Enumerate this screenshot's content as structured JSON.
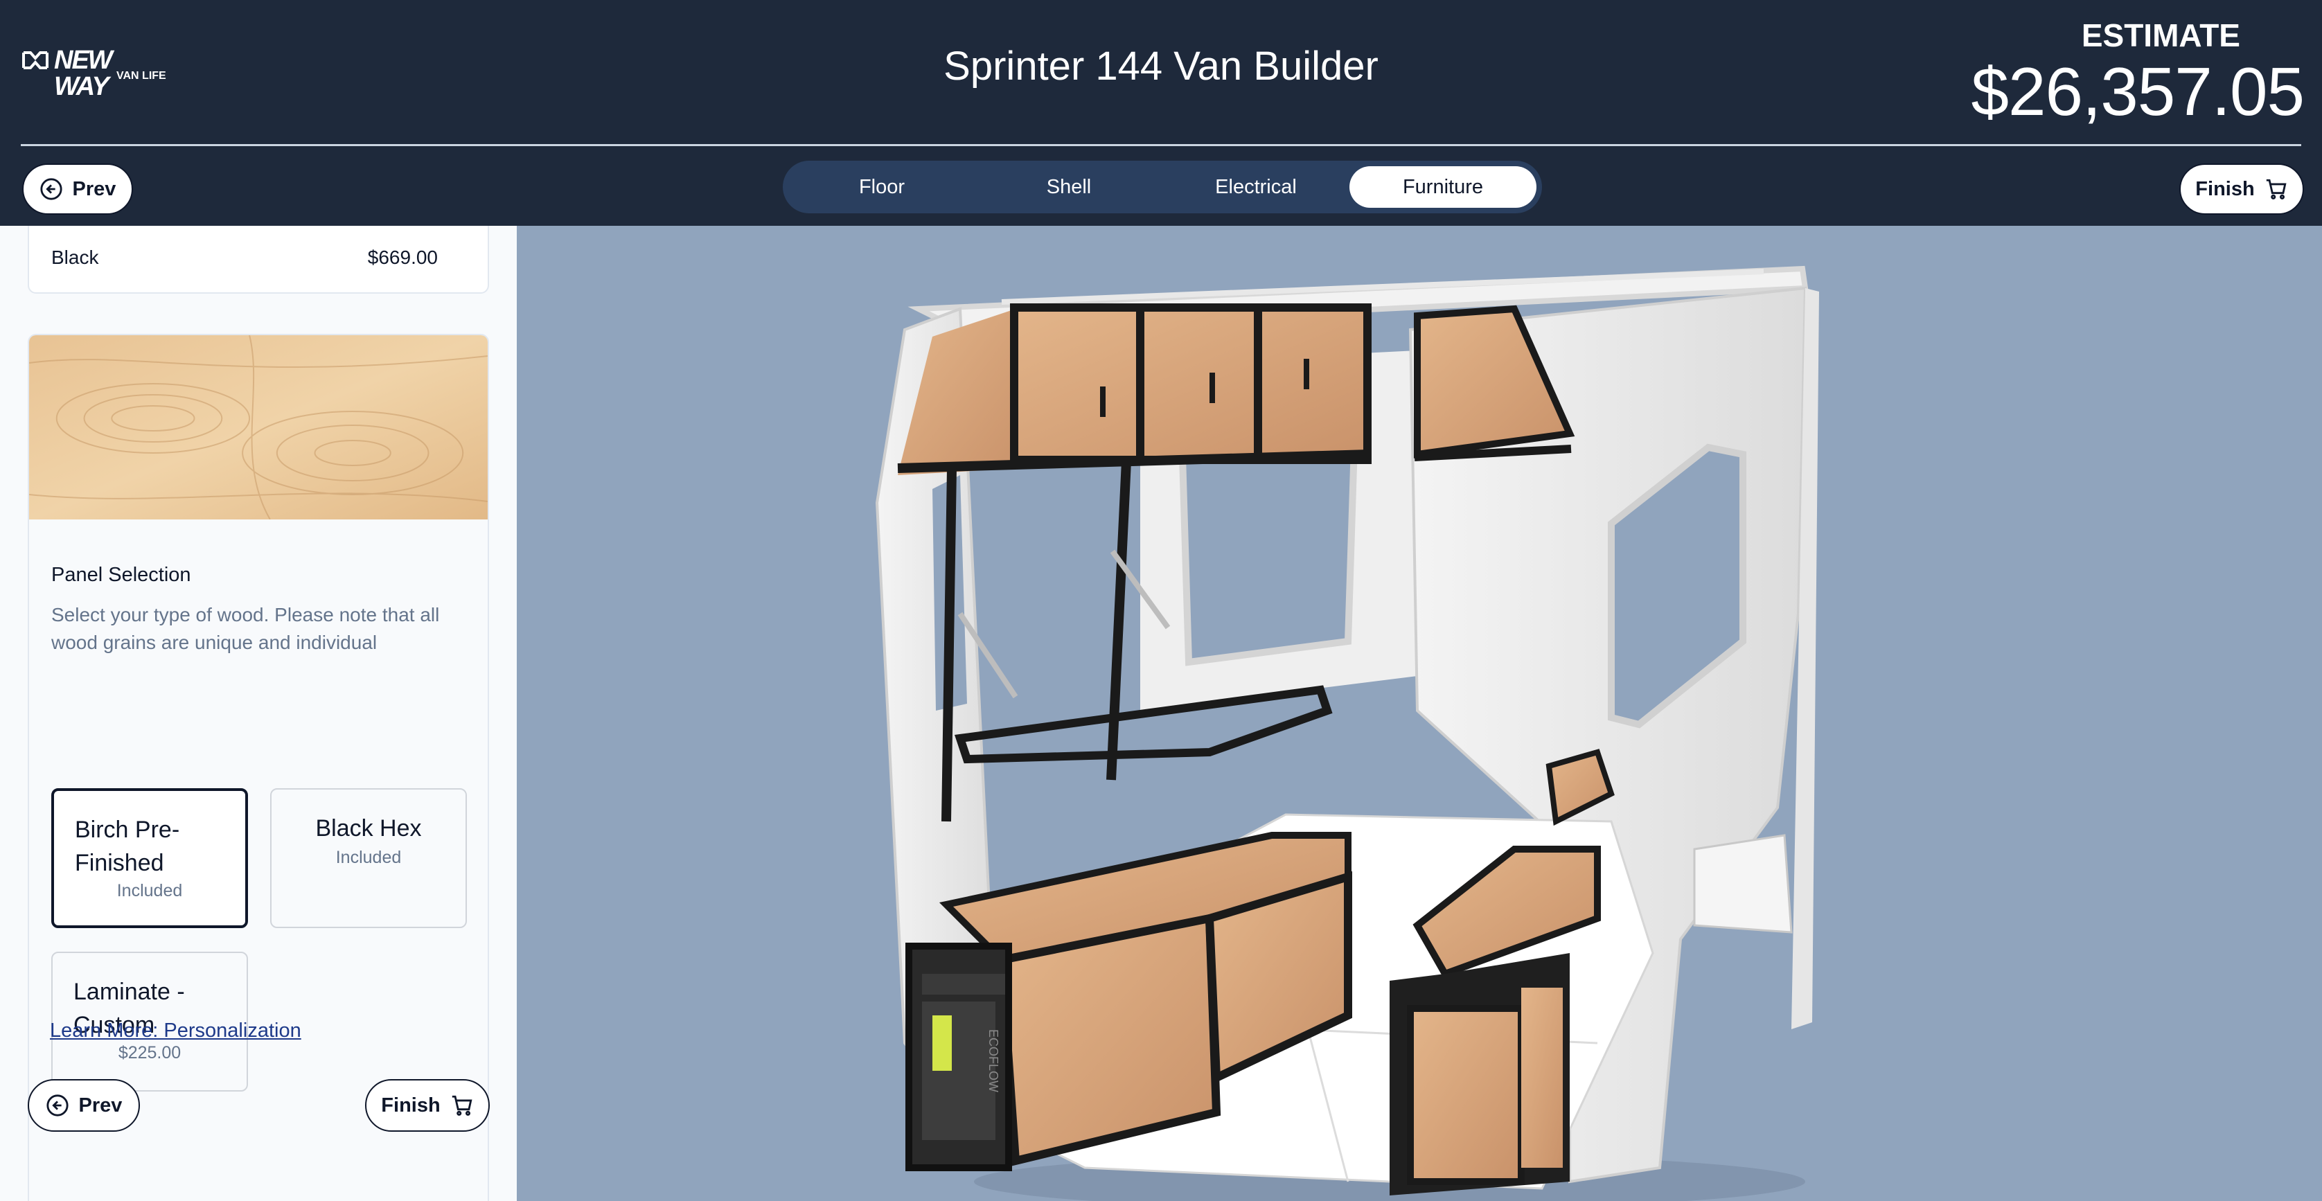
{
  "header": {
    "logo": {
      "brand": "NEW WAY",
      "sub": "VAN LIFE"
    },
    "title": "Sprinter 144 Van Builder",
    "estimate_label": "ESTIMATE",
    "estimate_value": "$26,357.05"
  },
  "nav": {
    "prev_label": "Prev",
    "finish_label": "Finish",
    "tabs": [
      {
        "label": "Floor",
        "active": false
      },
      {
        "label": "Shell",
        "active": false
      },
      {
        "label": "Electrical",
        "active": false
      },
      {
        "label": "Furniture",
        "active": true
      }
    ]
  },
  "sidebar": {
    "prev_item": {
      "label": "Black",
      "price": "$669.00"
    },
    "panel": {
      "title": "Panel Selection",
      "description": "Select your type of wood. Please note that all wood grains are unique and individual",
      "options": [
        {
          "name": "Birch Pre-Finished",
          "note": "Included",
          "selected": true
        },
        {
          "name": "Black Hex",
          "note": "Included",
          "selected": false
        },
        {
          "name": "Laminate - Custom",
          "note": "$225.00",
          "selected": false
        }
      ]
    },
    "learn_more": "Learn More: Personalization",
    "prev_label": "Prev",
    "finish_label": "Finish"
  },
  "viewer": {
    "background": "#90a4bd",
    "power_station_brand": "ECOFLOW"
  },
  "colors": {
    "header_bg": "#1e293b",
    "tab_bar_bg": "#2a3f5f",
    "wood": "#d9a77a",
    "frame": "#1a1a1a"
  }
}
